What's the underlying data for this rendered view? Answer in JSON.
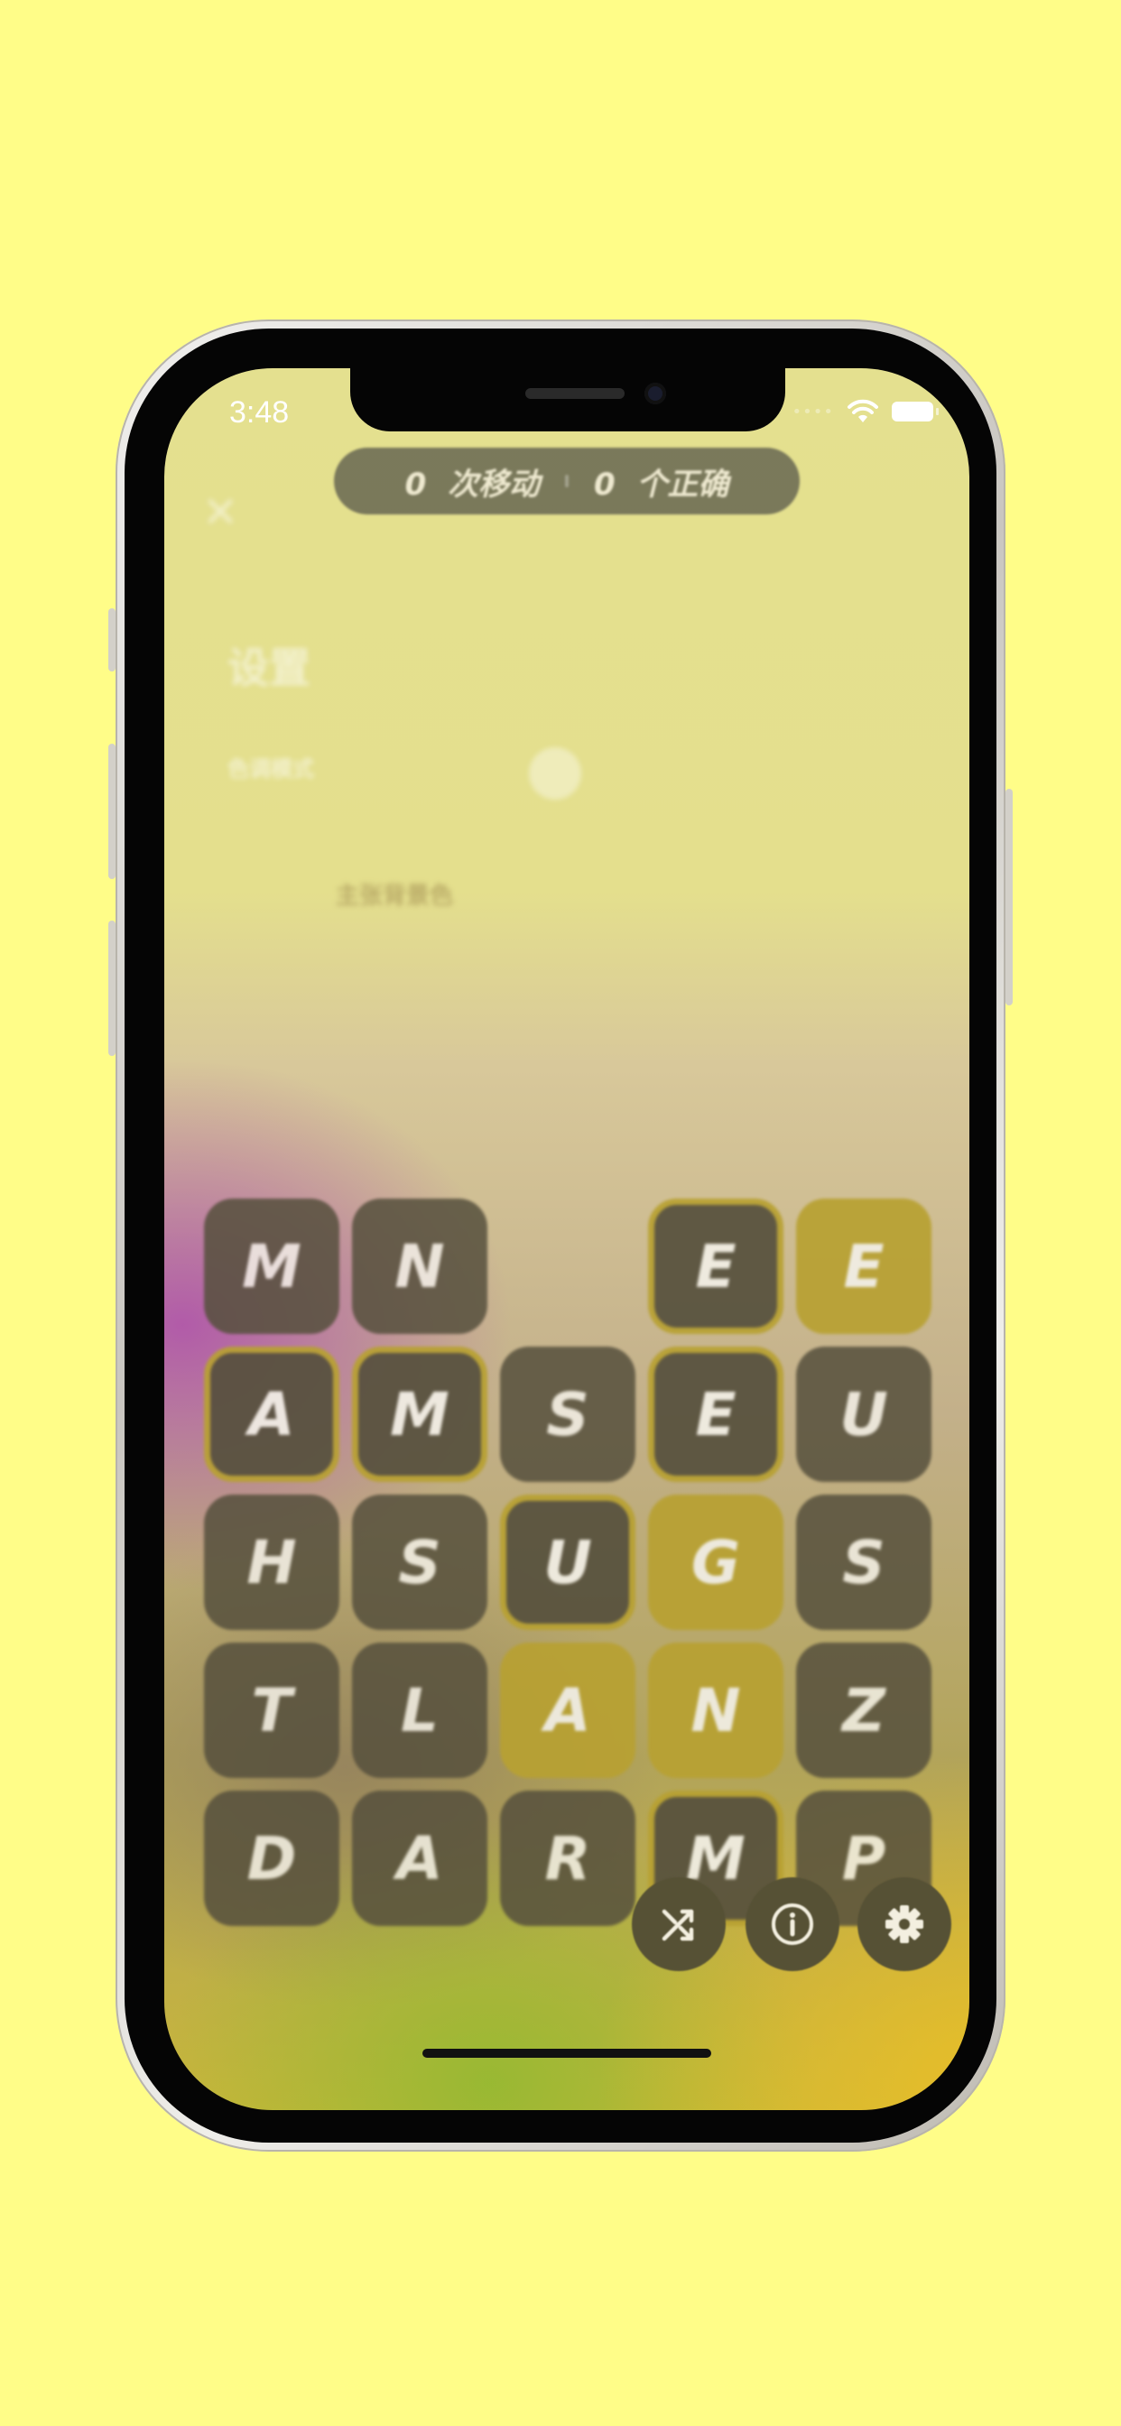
{
  "status_bar": {
    "time": "3:48"
  },
  "counter": {
    "moves_value": "0",
    "moves_label": "次移动",
    "correct_value": "0",
    "correct_label": "个正确"
  },
  "settings_overlay": {
    "title": "设置",
    "dark_mode_label": "色调模式",
    "background_label": "主张背景色"
  },
  "board": {
    "rows": [
      [
        {
          "letter": "M",
          "state": "dark"
        },
        {
          "letter": "N",
          "state": "dark"
        },
        {
          "letter": "",
          "state": "empty"
        },
        {
          "letter": "E",
          "state": "outlined"
        },
        {
          "letter": "E",
          "state": "gold"
        }
      ],
      [
        {
          "letter": "A",
          "state": "outlined"
        },
        {
          "letter": "M",
          "state": "outlined"
        },
        {
          "letter": "S",
          "state": "dark"
        },
        {
          "letter": "E",
          "state": "outlined"
        },
        {
          "letter": "U",
          "state": "dark"
        }
      ],
      [
        {
          "letter": "H",
          "state": "dark"
        },
        {
          "letter": "S",
          "state": "dark"
        },
        {
          "letter": "U",
          "state": "outlined"
        },
        {
          "letter": "G",
          "state": "gold"
        },
        {
          "letter": "S",
          "state": "dark"
        }
      ],
      [
        {
          "letter": "T",
          "state": "dark"
        },
        {
          "letter": "L",
          "state": "dark"
        },
        {
          "letter": "A",
          "state": "gold"
        },
        {
          "letter": "N",
          "state": "gold"
        },
        {
          "letter": "Z",
          "state": "dark"
        }
      ],
      [
        {
          "letter": "D",
          "state": "dark"
        },
        {
          "letter": "A",
          "state": "dark"
        },
        {
          "letter": "R",
          "state": "dark"
        },
        {
          "letter": "M",
          "state": "outlined"
        },
        {
          "letter": "P",
          "state": "dark"
        }
      ]
    ]
  },
  "colors": {
    "page_background": "#fffd88",
    "tile_dark": "#56503d",
    "tile_gold": "#b8a132",
    "tile_outline": "#b8a132"
  },
  "actions": [
    {
      "name": "shuffle-button",
      "icon": "shuffle-icon"
    },
    {
      "name": "info-button",
      "icon": "info-icon"
    },
    {
      "name": "settings-button",
      "icon": "gear-icon"
    }
  ]
}
